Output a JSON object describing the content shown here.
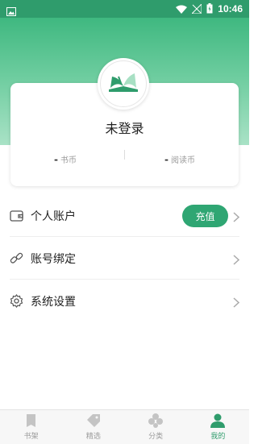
{
  "status_bar": {
    "time": "10:46"
  },
  "profile": {
    "login_status": "未登录",
    "stats": [
      {
        "value": "-",
        "label": "书币"
      },
      {
        "value": "-",
        "label": "阅读币"
      }
    ]
  },
  "menu": {
    "account": {
      "label": "个人账户",
      "button": "充值"
    },
    "binding": {
      "label": "账号绑定"
    },
    "settings": {
      "label": "系统设置"
    }
  },
  "tabs": [
    {
      "label": "书架",
      "active": false
    },
    {
      "label": "精选",
      "active": false
    },
    {
      "label": "分类",
      "active": false
    },
    {
      "label": "我的",
      "active": true
    }
  ],
  "colors": {
    "accent": "#2f9c6c",
    "button": "#2fa673"
  }
}
